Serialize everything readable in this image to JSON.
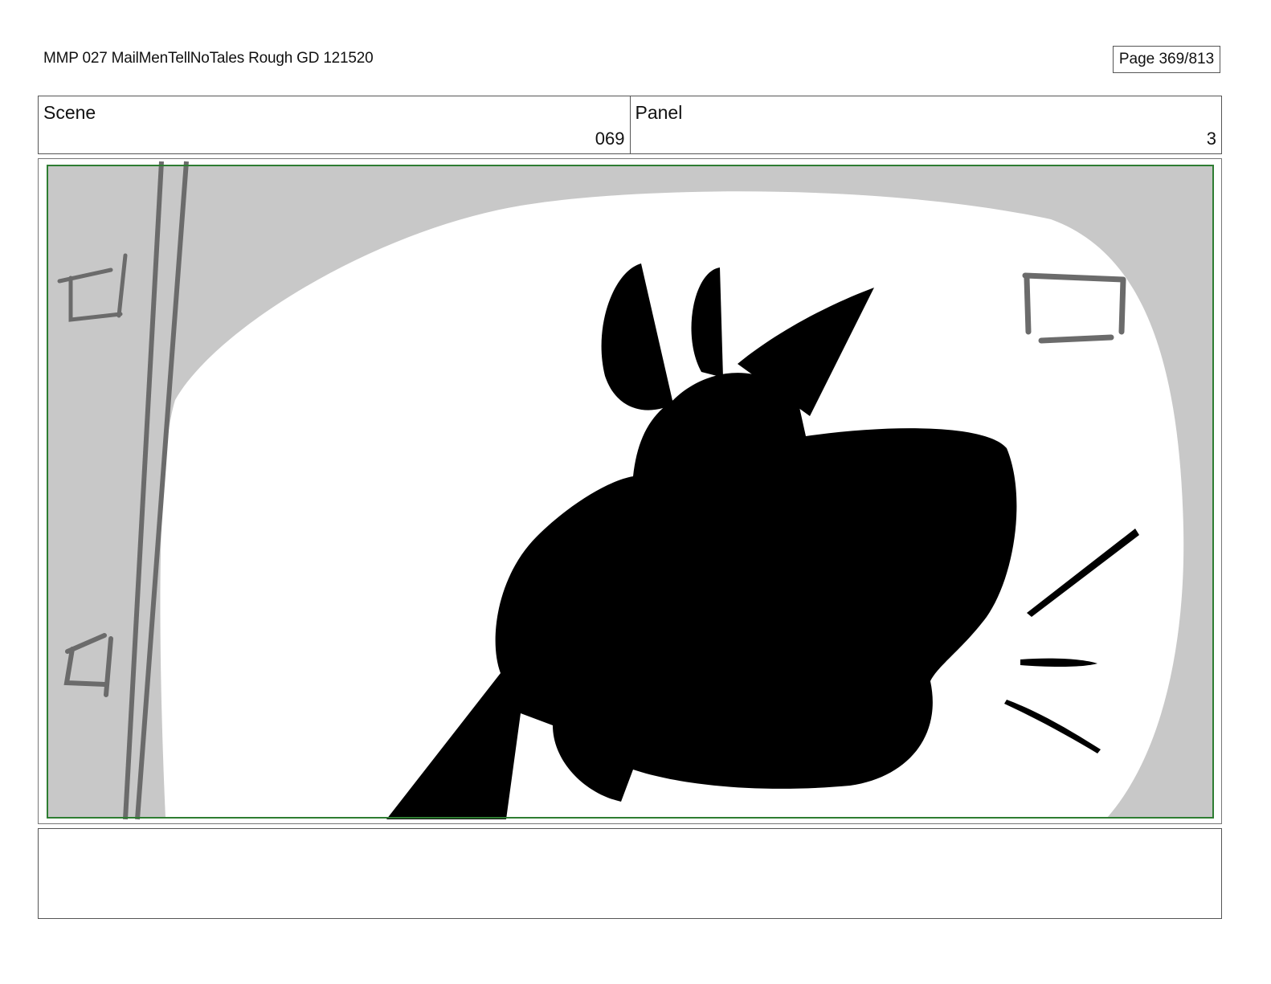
{
  "header": {
    "title": "MMP 027 MailMenTellNoTales Rough GD 121520",
    "page": "Page 369/813"
  },
  "info": {
    "scene_label": "Scene",
    "scene_value": "069",
    "panel_label": "Panel",
    "panel_value": "3"
  },
  "notes": {
    "text": ""
  },
  "colors": {
    "safe_frame": "#2e7d32",
    "background_gray": "#c8c8c8",
    "sketch_gray": "#6b6b6b",
    "silhouette": "#000000"
  }
}
